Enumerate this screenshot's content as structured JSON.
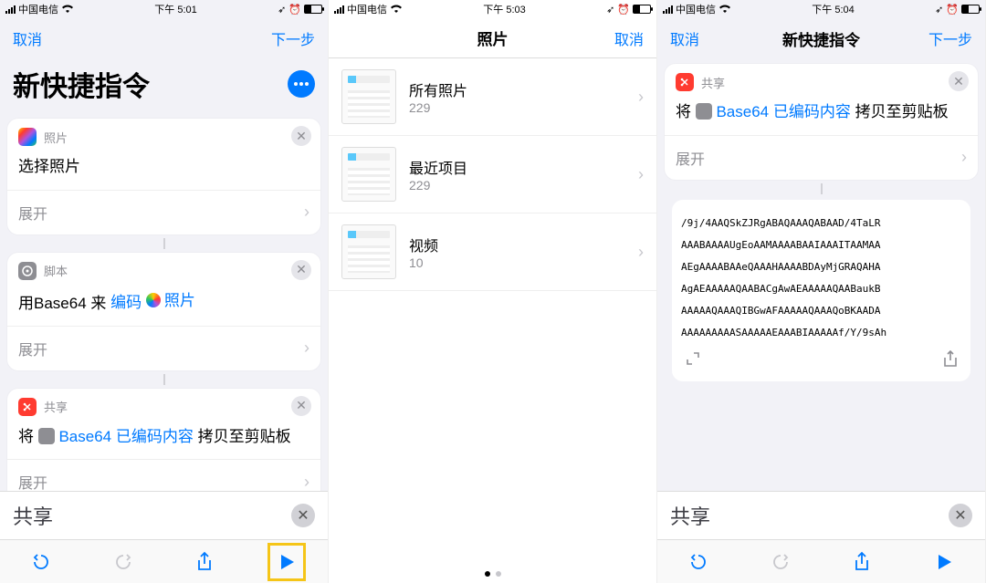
{
  "status": {
    "carrier": "中国电信",
    "wifi": true,
    "times": [
      "下午 5:01",
      "下午 5:03",
      "下午 5:04"
    ]
  },
  "nav": {
    "cancel": "取消",
    "next": "下一步",
    "title_new_shortcut": "新快捷指令",
    "photos_title": "照片"
  },
  "cards": {
    "photos": {
      "section": "照片",
      "body": "选择照片",
      "expand": "展开"
    },
    "script": {
      "section": "脚本",
      "prefix": "用Base64 来",
      "encode": "编码",
      "photos_token": "照片",
      "expand": "展开"
    },
    "share": {
      "section": "共享",
      "prefix": "将",
      "encoded_token": "Base64 已编码内容",
      "suffix": "拷贝至剪贴板",
      "expand": "展开"
    }
  },
  "search_label": "共享",
  "photo_albums": [
    {
      "title": "所有照片",
      "count": "229"
    },
    {
      "title": "最近项目",
      "count": "229"
    },
    {
      "title": "视频",
      "count": "10"
    }
  ],
  "output_lines": [
    "/9j/4AAQSkZJRgABAQAAAQABAAD/4TaLR",
    "AAABAAAAUgEoAAMAAAABAAIAAAITAAMAA",
    "AEgAAAABAAeQAAAHAAAABDAyMjGRAQAHA",
    "AgAEAAAAAQAABACgAwAEAAAAAQAABaukB",
    "AAAAAQAAAQIBGwAFAAAAAQAAAQoBKAADA",
    "AAAAAAAAASAAAAAEAAABIAAAAAf/Y/9sAh"
  ]
}
